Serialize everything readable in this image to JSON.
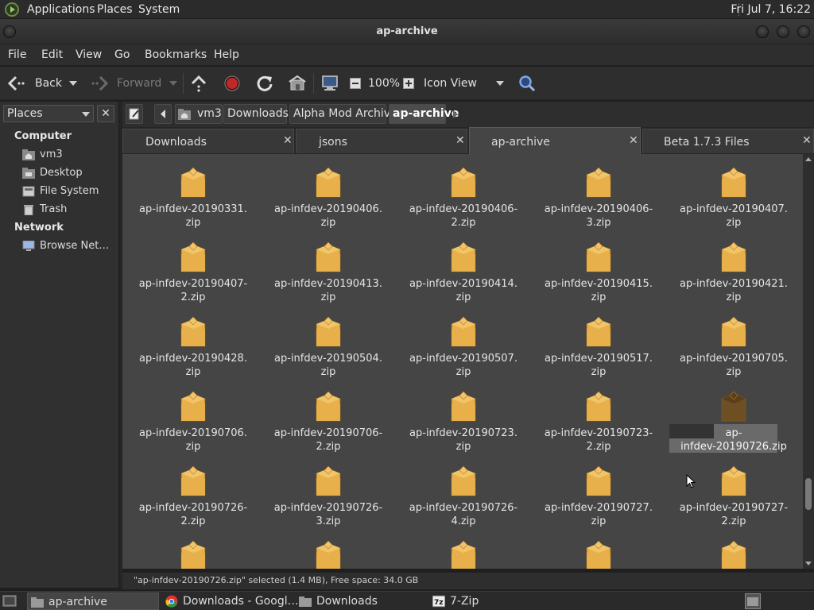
{
  "top_panel": {
    "menus": [
      "Applications",
      "Places",
      "System"
    ],
    "clock": "Fri Jul  7, 16:22"
  },
  "window": {
    "title": "ap-archive"
  },
  "menubar": [
    "File",
    "Edit",
    "View",
    "Go",
    "Bookmarks",
    "Help"
  ],
  "toolbar": {
    "back_label": "Back",
    "forward_label": "Forward",
    "zoom": "100%",
    "view_mode": "Icon View"
  },
  "sidebar": {
    "header": "Places",
    "close": "✕",
    "sections": [
      {
        "title": "Computer",
        "items": [
          {
            "label": "vm3",
            "icon": "home-folder-icon"
          },
          {
            "label": "Desktop",
            "icon": "desktop-folder-icon"
          },
          {
            "label": "File System",
            "icon": "drive-icon"
          },
          {
            "label": "Trash",
            "icon": "trash-icon"
          }
        ]
      },
      {
        "title": "Network",
        "items": [
          {
            "label": "Browse Net…",
            "icon": "network-icon"
          }
        ]
      }
    ]
  },
  "breadcrumbs": [
    "vm3",
    "Downloads",
    "Alpha Mod Archive",
    "ap-archive"
  ],
  "tabs": [
    {
      "label": "Downloads",
      "active": false
    },
    {
      "label": "jsons",
      "active": false
    },
    {
      "label": "ap-archive",
      "active": true
    },
    {
      "label": "Beta 1.7.3 Files",
      "active": false
    }
  ],
  "tab_close": "✕",
  "files": [
    {
      "line1": "ap-infdev-20190331.",
      "line2": "zip"
    },
    {
      "line1": "ap-infdev-20190406.",
      "line2": "zip"
    },
    {
      "line1": "ap-infdev-20190406-",
      "line2": "2.zip"
    },
    {
      "line1": "ap-infdev-20190406-",
      "line2": "3.zip"
    },
    {
      "line1": "ap-infdev-20190407.",
      "line2": "zip"
    },
    {
      "line1": "ap-infdev-20190407-",
      "line2": "2.zip"
    },
    {
      "line1": "ap-infdev-20190413.",
      "line2": "zip"
    },
    {
      "line1": "ap-infdev-20190414.",
      "line2": "zip"
    },
    {
      "line1": "ap-infdev-20190415.",
      "line2": "zip"
    },
    {
      "line1": "ap-infdev-20190421.",
      "line2": "zip"
    },
    {
      "line1": "ap-infdev-20190428.",
      "line2": "zip"
    },
    {
      "line1": "ap-infdev-20190504.",
      "line2": "zip"
    },
    {
      "line1": "ap-infdev-20190507.",
      "line2": "zip"
    },
    {
      "line1": "ap-infdev-20190517.",
      "line2": "zip"
    },
    {
      "line1": "ap-infdev-20190705.",
      "line2": "zip"
    },
    {
      "line1": "ap-infdev-20190706.",
      "line2": "zip"
    },
    {
      "line1": "ap-infdev-20190706-",
      "line2": "2.zip"
    },
    {
      "line1": "ap-infdev-20190723.",
      "line2": "zip"
    },
    {
      "line1": "ap-infdev-20190723-",
      "line2": "2.zip"
    },
    {
      "line1": "ap-",
      "line2": "infdev-20190726.zip",
      "selected": true
    },
    {
      "line1": "ap-infdev-20190726-",
      "line2": "2.zip"
    },
    {
      "line1": "ap-infdev-20190726-",
      "line2": "3.zip"
    },
    {
      "line1": "ap-infdev-20190726-",
      "line2": "4.zip"
    },
    {
      "line1": "ap-infdev-20190727.",
      "line2": "zip"
    },
    {
      "line1": "ap-infdev-20190727-",
      "line2": "2.zip"
    },
    {
      "line1": "",
      "line2": ""
    },
    {
      "line1": "",
      "line2": ""
    },
    {
      "line1": "",
      "line2": ""
    },
    {
      "line1": "",
      "line2": ""
    },
    {
      "line1": "",
      "line2": ""
    }
  ],
  "status": "\"ap-infdev-20190726.zip\" selected (1.4 MB), Free space: 34.0 GB",
  "taskbar": [
    {
      "label": "ap-archive",
      "icon": "folder-icon",
      "active": true
    },
    {
      "label": "Downloads - Googl…",
      "icon": "chrome-icon",
      "active": false
    },
    {
      "label": "Downloads",
      "icon": "folder-icon",
      "active": false
    },
    {
      "label": "7-Zip",
      "icon": "7zip-icon",
      "active": false
    }
  ],
  "colors": {
    "accent": "#9acd5a",
    "archive_icon": "#e8b04a",
    "selected_icon": "#6e4f24"
  }
}
